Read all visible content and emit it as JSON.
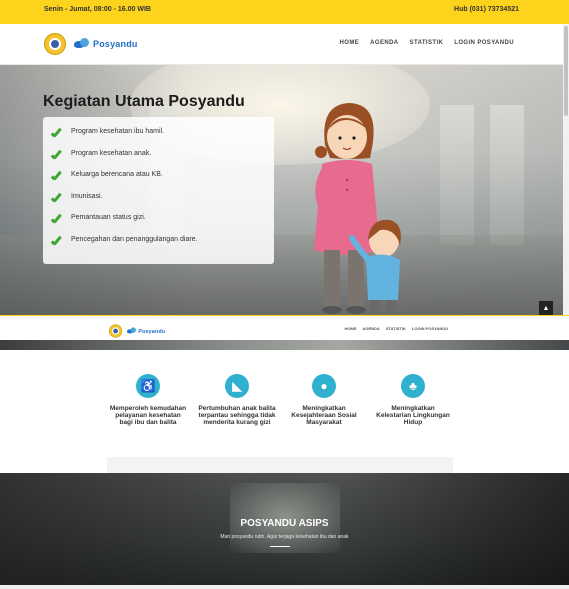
{
  "topbar": {
    "hours": "Senin - Jumat, 08:00 - 16.00 WIB",
    "phone": "Hub (031) 73734521"
  },
  "brand": {
    "name": "Posyandu"
  },
  "nav": {
    "items": [
      "HOME",
      "AGENDA",
      "STATISTIK",
      "LOGIN POSYANDU"
    ]
  },
  "hero": {
    "title": "Kegiatan Utama Posyandu",
    "items": [
      "Program kesehatan ibu hamil.",
      "Program kesehatan anak.",
      "Keluarga berencana atau KB.",
      "Imunisasi.",
      "Pemantauan status gizi.",
      "Pencegahan dan penanggulangan diare."
    ]
  },
  "scroll_top": {
    "icon": "chevron-up-icon",
    "glyph": "▲"
  },
  "features": [
    {
      "icon": "accessibility-icon",
      "glyph": "♿",
      "label": "Memperoleh kemudahan pelayanan kesehatan bagi ibu dan balita"
    },
    {
      "icon": "growth-chart-icon",
      "glyph": "◣",
      "label": "Pertumbuhan anak balita terpantau sehingga tidak menderita kurang gizi"
    },
    {
      "icon": "person-icon",
      "glyph": "●",
      "label": "Meningkatkan Kesejahteraan Sosial Masyarakat"
    },
    {
      "icon": "tree-icon",
      "glyph": "♣",
      "label": "Meningkatkan Kelestarian Lingkungan Hidup"
    }
  ],
  "banner": {
    "title": "POSYANDU ASIPS",
    "subtitle": "Mari posyandu rutin. Agar terjaga kesehatan ibu dan anak"
  },
  "colors": {
    "topbar": "#fdd31b",
    "accent": "#2fb0cf",
    "check": "#3fa535",
    "brand": "#1f6fc4"
  }
}
